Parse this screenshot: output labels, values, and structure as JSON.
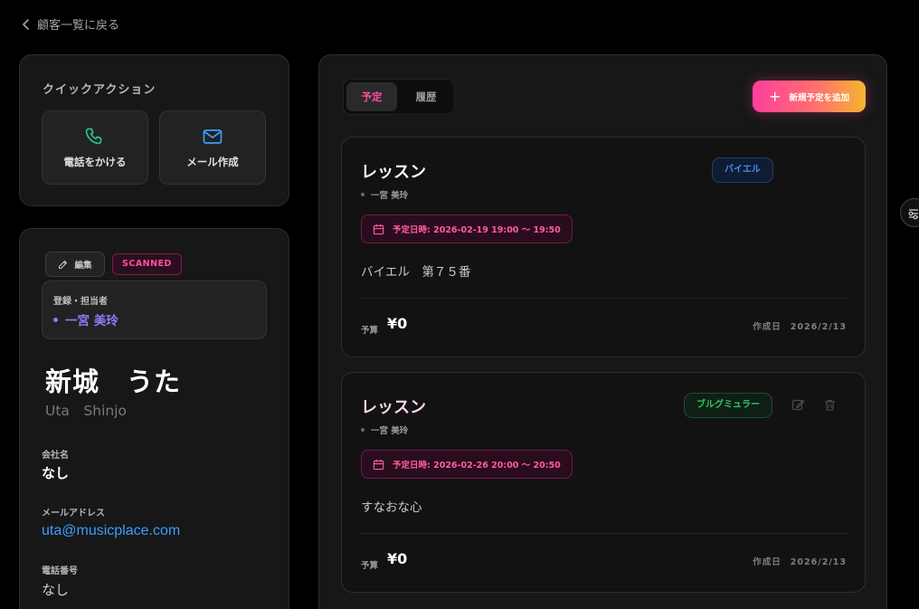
{
  "nav": {
    "back_label": "顧客一覧に戻る"
  },
  "quick_actions": {
    "title": "クイックアクション",
    "call_label": "電話をかける",
    "mail_label": "メール作成"
  },
  "profile": {
    "edit_label": "編集",
    "status_badge": "SCANNED",
    "staff_label": "登録・担当者",
    "staff_name": "一宮 美玲",
    "name_jp": "新城　うた",
    "name_en": "Uta　Shinjo",
    "fields": [
      {
        "label": "会社名",
        "value": "なし"
      },
      {
        "label": "メールアドレス",
        "value": "uta@musicplace.com"
      },
      {
        "label": "電話番号",
        "value": "なし"
      }
    ]
  },
  "schedule": {
    "tabs": [
      {
        "label": "予定",
        "active": true
      },
      {
        "label": "履歴",
        "active": false
      }
    ],
    "add_label": "新規予定を追加",
    "appointments": [
      {
        "title": "レッスン",
        "staff": "一宮 美玲",
        "badge": "バイエル",
        "badge_color": "#4d8bff",
        "date": "予定日時: 2026-02-19 19:00 〜 19:50",
        "note": "バイエル　第７５番",
        "budget_label": "予算",
        "budget": "¥0",
        "created_label": "作成日",
        "created": "2026/2/13"
      },
      {
        "title": "レッスン",
        "staff": "一宮 美玲",
        "badge": "ブルグミュラー",
        "badge_color": "#3cc35c",
        "date": "予定日時: 2026-02-26 20:00 〜 20:50",
        "note": "すなおな心",
        "budget_label": "予算",
        "budget": "¥0",
        "created_label": "作成日",
        "created": "2026/2/13"
      }
    ]
  },
  "colors": {
    "accent_pink": "#ff4fa0",
    "accent_purple": "#8b7cf6",
    "link_blue": "#3b9dff",
    "phone_green": "#22c493",
    "mail_blue": "#3b9dff"
  }
}
